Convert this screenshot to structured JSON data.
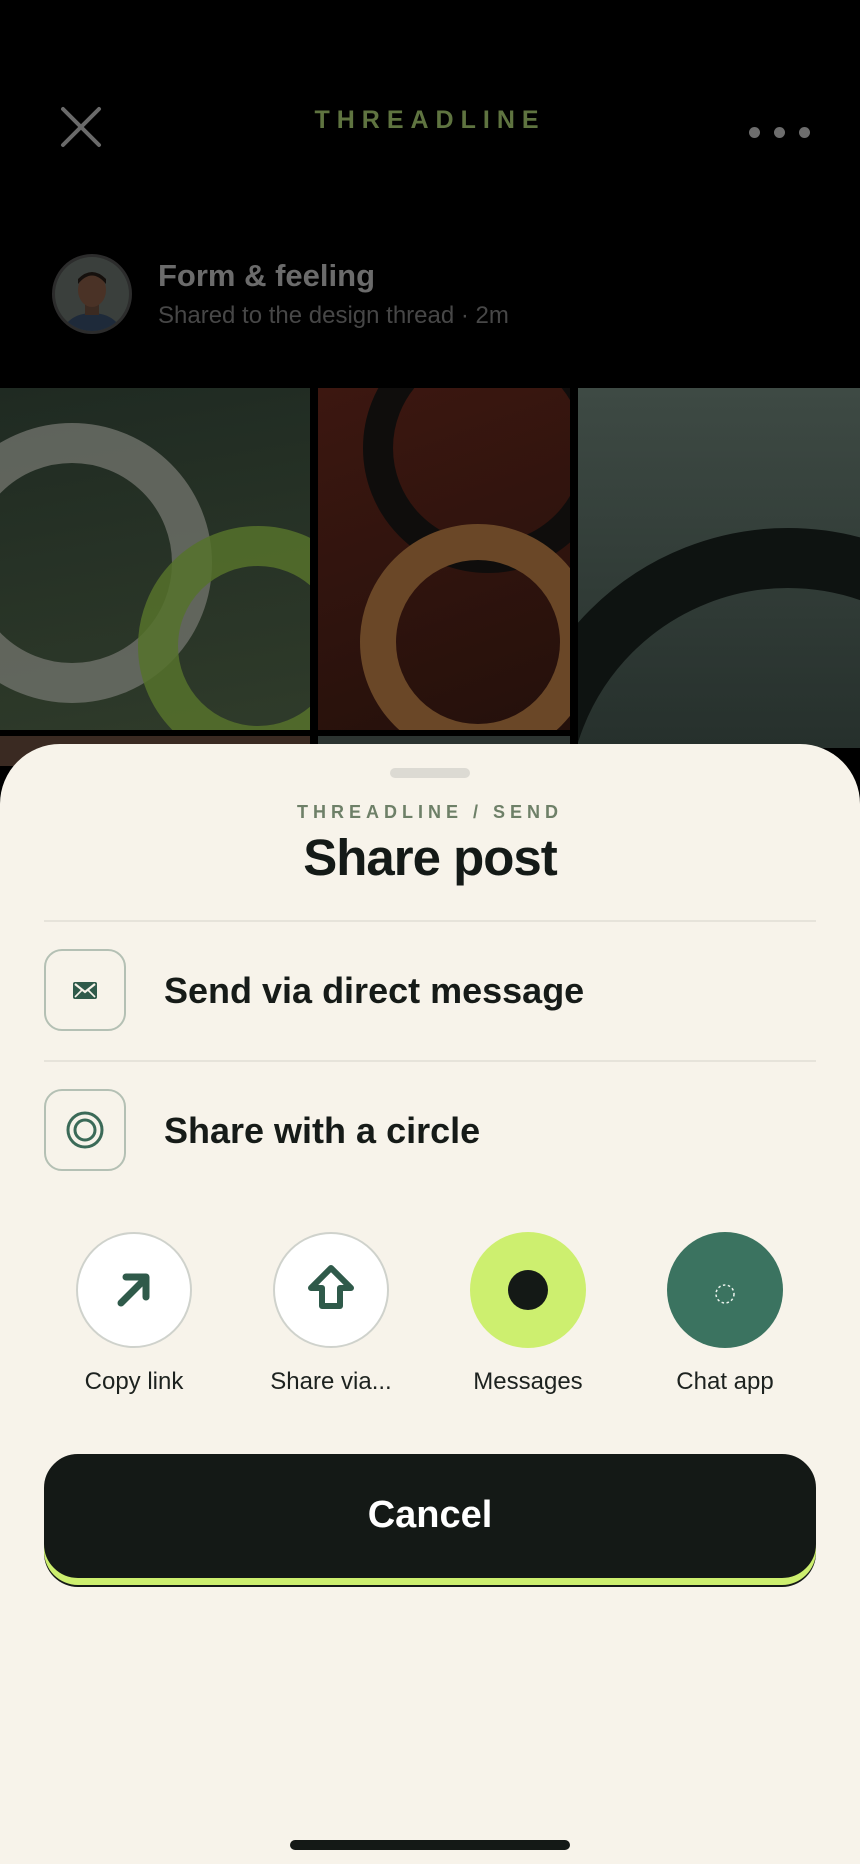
{
  "header": {
    "brand": "THREADLINE",
    "close_icon": "close-icon",
    "more_icon": "more-horizontal-icon"
  },
  "post": {
    "author_name": "Form & feeling",
    "subtitle": "Shared to the design thread · 2m"
  },
  "sheet": {
    "eyebrow": "THREADLINE / SEND",
    "title": "Share post",
    "rows": [
      {
        "label": "Send via direct message",
        "icon": "envelope-icon"
      },
      {
        "label": "Share with a circle",
        "icon": "circle-icon"
      }
    ],
    "targets": [
      {
        "label": "Copy link",
        "icon": "arrow-up-right-icon"
      },
      {
        "label": "Share via...",
        "icon": "share-arrow-up-icon"
      },
      {
        "label": "Messages",
        "icon": "messages-icon"
      },
      {
        "label": "Chat app",
        "icon": "chat-app-icon"
      }
    ],
    "cancel_label": "Cancel"
  },
  "colors": {
    "accent_lime": "#cdef6f",
    "dark": "#141916",
    "teal": "#3b7360",
    "sheet_bg": "#f7f3ea"
  }
}
